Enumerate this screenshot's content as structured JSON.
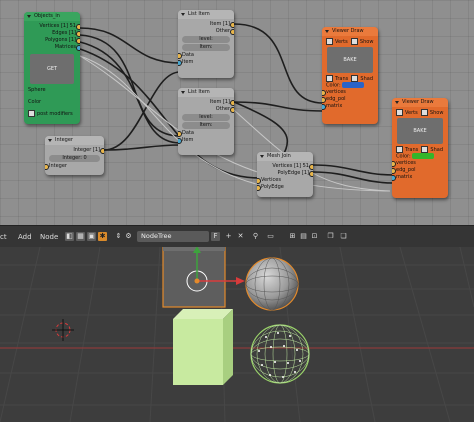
{
  "node_editor": {
    "objects_in": {
      "title": "Objects_in",
      "vertices": "Vertices [1] 51",
      "edges": "Edges [1]",
      "polygons": "Polygons [1]",
      "matrices": "Matrices",
      "get_label": "GET",
      "name": "Sphere",
      "color": "Color",
      "post_modifiers": "post modifiers"
    },
    "list_item_1": {
      "title": "List Item",
      "item": "Item [1]",
      "other": "Other",
      "level": "level:",
      "item_field": "Item:",
      "data": "Data",
      "item_in": "Item"
    },
    "list_item_2": {
      "title": "List Item",
      "item": "Item [1]",
      "other": "Other",
      "level": "level:",
      "item_field": "Item:",
      "data": "Data",
      "item_in": "Item"
    },
    "integer": {
      "title": "Integer",
      "integer_out": "Integer [1]",
      "integer_field": "Integer: 0",
      "integer_in": "Integer"
    },
    "mesh_join": {
      "title": "Mesh Join",
      "vertices": "Vertices [1] 51",
      "poly_edge": "PolyEdge [1]",
      "vertices_in": "Vertices",
      "poly_edge_in": "PolyEdge"
    },
    "viewer_draw_1": {
      "title": "Viewer Draw",
      "verts": "Verts",
      "show": "Show",
      "bake": "BAKE",
      "trans": "Trans",
      "shad": "Shad",
      "color": "Color:",
      "swatch": "#2b63c8",
      "vertices": "vertices",
      "edg_pol": "edg_pol",
      "matrix": "matrix"
    },
    "viewer_draw_2": {
      "title": "Viewer Draw",
      "verts": "Verts",
      "show": "Show",
      "bake": "BAKE",
      "trans": "Trans",
      "shad": "Shad",
      "color": "Color:",
      "swatch": "#34b52a",
      "vertices": "vertices",
      "edg_pol": "edg_pol",
      "matrix": "matrix"
    }
  },
  "toolbar": {
    "select": "ct",
    "add": "Add",
    "node": "Node",
    "tree_name": "NodeTree",
    "fake_user": "F",
    "add_tree": "+",
    "remove_tree": "✕"
  },
  "colors": {
    "accent_orange": "#e16a2c",
    "node_green": "#2f9a56",
    "mesh_green": "#c8eaa0"
  }
}
